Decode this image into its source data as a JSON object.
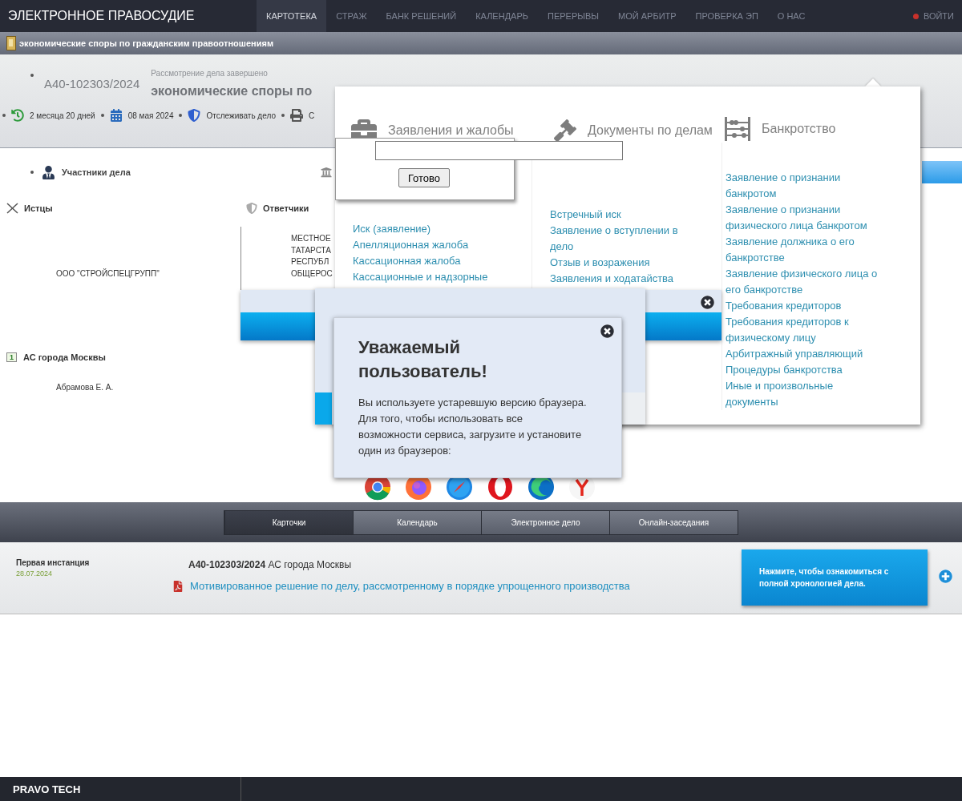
{
  "nav": {
    "brand": "ЭЛЕКТРОННОЕ ПРАВОСУДИЕ",
    "tabs": [
      {
        "label": "КАРТОТЕКА",
        "selected": true
      },
      {
        "label": "СТРАЖ",
        "selected": false
      },
      {
        "label": "БАНК РЕШЕНИЙ",
        "selected": false
      },
      {
        "label": "КАЛЕНДАРЬ",
        "selected": false
      },
      {
        "label": "ПЕРЕРЫВЫ",
        "selected": false
      },
      {
        "label": "МОЙ АРБИТР",
        "selected": false
      },
      {
        "label": "ПРОВЕРКА ЭП",
        "selected": false
      },
      {
        "label": "О НАС",
        "selected": false
      }
    ],
    "login": "ВОЙТИ"
  },
  "category": "экономические споры по гражданским правоотношениям",
  "case": {
    "number": "А40-102303/2024",
    "status": "Рассмотрение дела завершено",
    "title": "экономические споры по",
    "meta": [
      {
        "kind": "duration",
        "text": "2 месяца 20 дней"
      },
      {
        "kind": "date",
        "text": "08 мая 2024"
      },
      {
        "kind": "track",
        "text": "Отслеживать дело"
      },
      {
        "kind": "print",
        "text": "С"
      }
    ]
  },
  "participants": {
    "title": "Участники дела",
    "plaintiffs": {
      "title": "Истцы",
      "items": [
        "ООО \"СТРОЙСПЕЦГРУПП\""
      ]
    },
    "defendants": {
      "title": "Ответчики",
      "lines": [
        "МЕСТНОЕ",
        "ТАТАРСТА",
        "РЕСПУБЛ",
        "ОБЩЕРОС"
      ]
    }
  },
  "court": {
    "badge": "1",
    "name": "АС города Москвы",
    "judge": "Абрамова Е. А."
  },
  "documents_menu": {
    "columns": [
      {
        "kind": "briefcase",
        "title": "Заявления и жалобы",
        "links": [
          "Иск (заявление)",
          "Апелляционная жалоба",
          "Кассационная жалоба",
          "Кассационные и надзорные"
        ]
      },
      {
        "kind": "gavel",
        "title": "Документы по делам",
        "links": [
          "Встречный иск",
          "Заявление о вступлении в дело",
          "Отзыв и возражения",
          "Заявления и ходатайства"
        ]
      },
      {
        "kind": "abacus",
        "title": "Банкротство",
        "links": [
          "Заявление о признании банкротом",
          "Заявление о признании физического лица банкротом",
          "Заявление должника о его банкротстве",
          "Заявление физического лица о его банкротстве",
          "Требования кредиторов",
          "Требования кредиторов к физическому лицу",
          "Арбитражный управляющий",
          "Процедуры банкротства",
          "Иные и произвольные документы"
        ]
      }
    ]
  },
  "quick_input": {
    "button": "Готово"
  },
  "browser_notice": {
    "title": "Уважаемый пользователь!",
    "text": "Вы используете устаревшую версию браузера. Для того, чтобы использовать все возможности сервиса, загрузите и установите один из браузеров:",
    "browsers": [
      {
        "kind": "chrome"
      },
      {
        "kind": "firefox"
      },
      {
        "kind": "safari"
      },
      {
        "kind": "opera"
      },
      {
        "kind": "edge"
      },
      {
        "kind": "yandex"
      }
    ]
  },
  "bottom_tabs": [
    {
      "label": "Карточки",
      "selected": true
    },
    {
      "label": "Календарь",
      "selected": false
    },
    {
      "label": "Электронное дело",
      "selected": false
    },
    {
      "label": "Онлайн-заседания",
      "selected": false
    }
  ],
  "instance": {
    "title": "Первая инстанция",
    "date": "28.07.2024",
    "heading": "**А40-102303/2024** АС города Москвы",
    "document": "Мотивированное решение по делу, рассмотренному в порядке упрощенного производства"
  },
  "hint": "Нажмите, чтобы ознакомиться с полной хронологией дела.",
  "footer": "PRAVO TECH"
}
